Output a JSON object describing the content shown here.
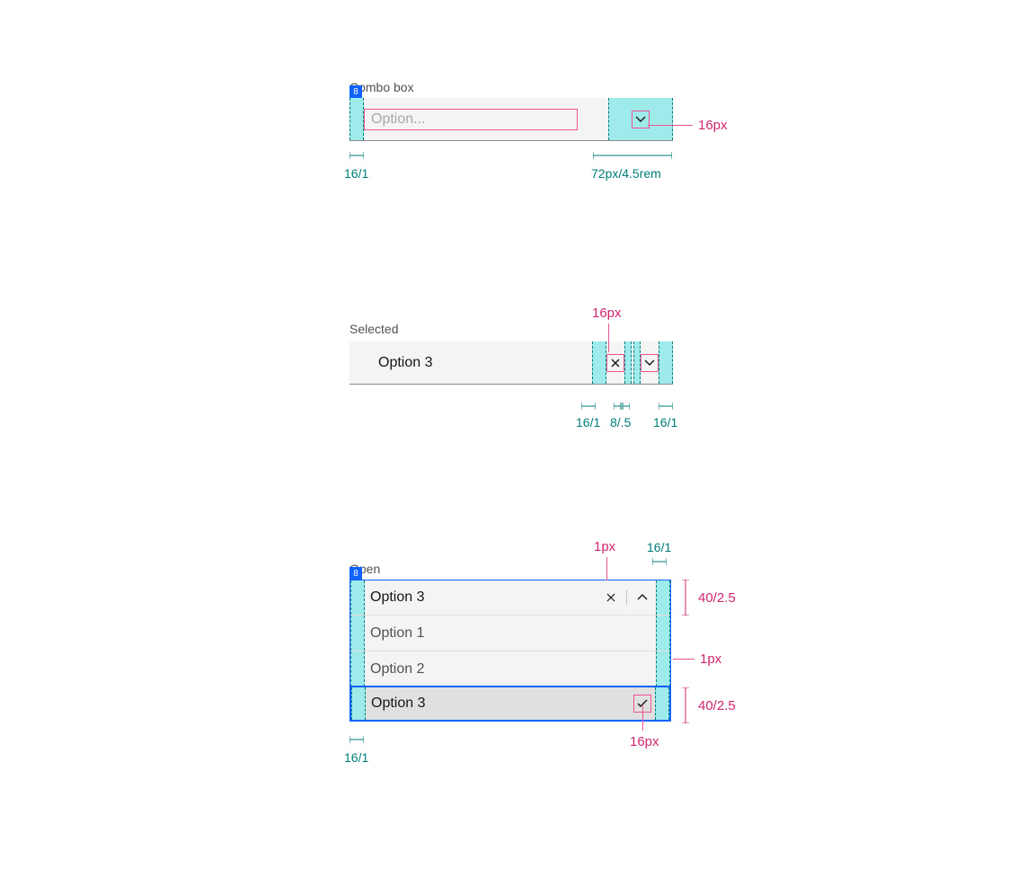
{
  "section1": {
    "title": "Combo box",
    "badge": "8",
    "placeholder": "Option...",
    "annotations": {
      "icon_size": "16px",
      "left_padding": "16/1",
      "right_width": "72px/4.5rem"
    }
  },
  "section2": {
    "title": "Selected",
    "value": "Option 3",
    "annotations": {
      "icon_size": "16px",
      "spacing_16": "16/1",
      "spacing_8": "8/.5",
      "spacing_16b": "16/1"
    }
  },
  "section3": {
    "title": "Open",
    "badge": "8",
    "selected_value": "Option 3",
    "options": [
      "Option 1",
      "Option 2",
      "Option 3"
    ],
    "annotations": {
      "divider": "1px",
      "right_16": "16/1",
      "row_height": "40/2.5",
      "menu_divider": "1px",
      "selected_height": "40/2.5",
      "check_size": "16px",
      "left_16": "16/1"
    }
  }
}
